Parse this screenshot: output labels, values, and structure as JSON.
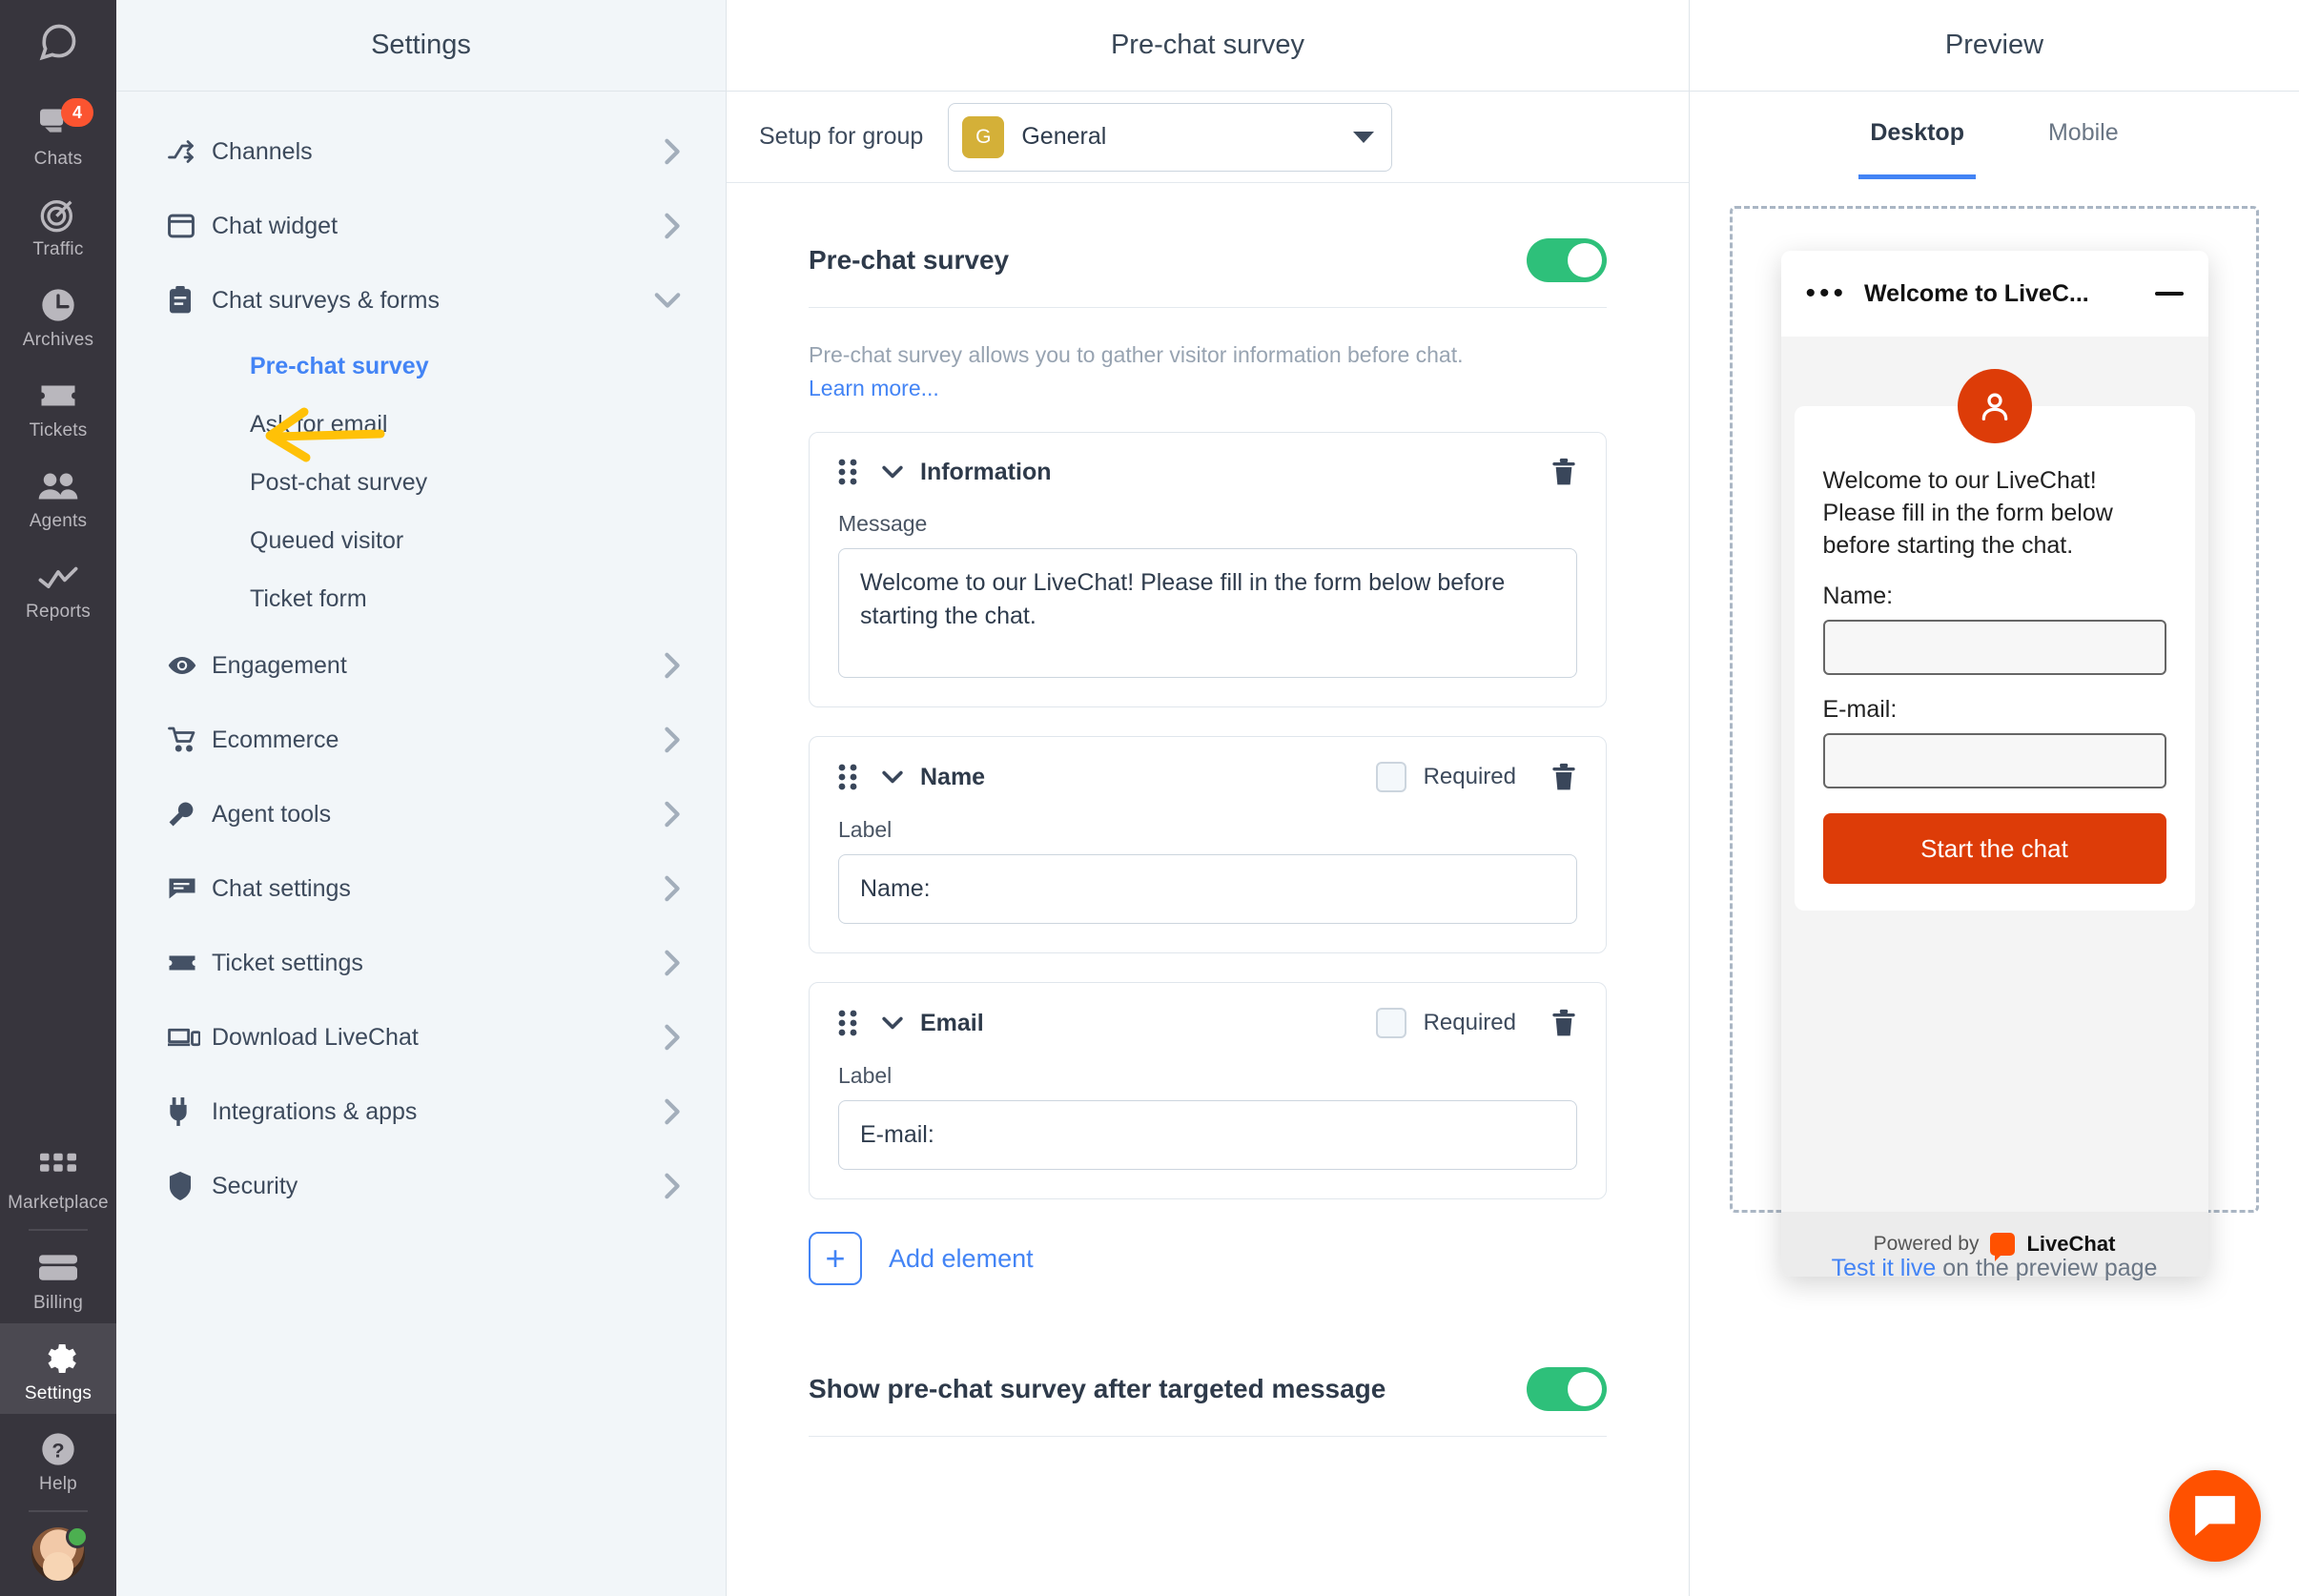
{
  "rail": {
    "logo_icon": "livechat-logo-icon",
    "items": [
      {
        "label": "Chats",
        "icon": "chats-icon",
        "badge": "4",
        "active": false
      },
      {
        "label": "Traffic",
        "icon": "traffic-icon",
        "badge": "",
        "active": false
      },
      {
        "label": "Archives",
        "icon": "archives-clock-icon",
        "badge": "",
        "active": false
      },
      {
        "label": "Tickets",
        "icon": "tickets-icon",
        "badge": "",
        "active": false
      },
      {
        "label": "Agents",
        "icon": "agents-icon",
        "badge": "",
        "active": false
      },
      {
        "label": "Reports",
        "icon": "reports-chart-icon",
        "badge": "",
        "active": false
      }
    ],
    "bottom_items": [
      {
        "label": "Marketplace",
        "icon": "marketplace-grid-icon",
        "active": false
      },
      {
        "label": "Billing",
        "icon": "billing-card-icon",
        "active": false
      },
      {
        "label": "Settings",
        "icon": "gear-icon",
        "active": true
      },
      {
        "label": "Help",
        "icon": "help-question-icon",
        "active": false
      }
    ]
  },
  "settings": {
    "title": "Settings",
    "items": [
      {
        "label": "Channels",
        "icon": "channels-icon",
        "type": "parent",
        "expanded": false
      },
      {
        "label": "Chat widget",
        "icon": "chat-widget-icon",
        "type": "parent",
        "expanded": false
      },
      {
        "label": "Chat surveys & forms",
        "icon": "clipboard-icon",
        "type": "parent",
        "expanded": true
      },
      {
        "label": "Pre-chat survey",
        "type": "child",
        "active": true
      },
      {
        "label": "Ask for email",
        "type": "child",
        "active": false
      },
      {
        "label": "Post-chat survey",
        "type": "child",
        "active": false
      },
      {
        "label": "Queued visitor",
        "type": "child",
        "active": false
      },
      {
        "label": "Ticket form",
        "type": "child",
        "active": false
      },
      {
        "label": "Engagement",
        "icon": "eye-icon",
        "type": "parent",
        "expanded": false
      },
      {
        "label": "Ecommerce",
        "icon": "cart-icon",
        "type": "parent",
        "expanded": false
      },
      {
        "label": "Agent tools",
        "icon": "wrench-icon",
        "type": "parent",
        "expanded": false
      },
      {
        "label": "Chat settings",
        "icon": "chat-bubble-icon",
        "type": "parent",
        "expanded": false
      },
      {
        "label": "Ticket settings",
        "icon": "ticket-icon",
        "type": "parent",
        "expanded": false
      },
      {
        "label": "Download LiveChat",
        "icon": "devices-icon",
        "type": "parent",
        "expanded": false
      },
      {
        "label": "Integrations & apps",
        "icon": "plug-icon",
        "type": "parent",
        "expanded": false
      },
      {
        "label": "Security",
        "icon": "shield-icon",
        "type": "parent",
        "expanded": false
      }
    ]
  },
  "main": {
    "title": "Pre-chat survey",
    "setup_for_group_label": "Setup for group",
    "group": {
      "initial": "G",
      "name": "General",
      "color": "#d4b038"
    },
    "section": {
      "title": "Pre-chat survey",
      "enabled": true,
      "description": "Pre-chat survey allows you to gather visitor information before chat.",
      "learn_more": "Learn more..."
    },
    "elements": [
      {
        "name": "Information",
        "field_label": "Message",
        "value": "Welcome to our LiveChat! Please fill in the form below before starting the chat.",
        "has_required": false,
        "required": false
      },
      {
        "name": "Name",
        "field_label": "Label",
        "value": "Name:",
        "has_required": true,
        "required": false,
        "required_label": "Required"
      },
      {
        "name": "Email",
        "field_label": "Label",
        "value": "E-mail:",
        "has_required": true,
        "required": false,
        "required_label": "Required"
      }
    ],
    "add_element_label": "Add element",
    "targeted": {
      "label": "Show pre-chat survey after targeted message",
      "enabled": true
    }
  },
  "preview": {
    "title": "Preview",
    "tabs": [
      {
        "label": "Desktop",
        "active": true
      },
      {
        "label": "Mobile",
        "active": false
      }
    ],
    "widget": {
      "header_title": "Welcome to LiveC...",
      "dots": "•••",
      "message": "Welcome to our LiveChat! Please fill in the form below before starting the chat.",
      "fields": [
        {
          "label": "Name:",
          "value": ""
        },
        {
          "label": "E-mail:",
          "value": ""
        }
      ],
      "start_button": "Start the chat",
      "powered_by": "Powered by",
      "brand": "LiveChat"
    },
    "test_live_link": "Test it live",
    "test_live_rest": " on the preview page"
  },
  "colors": {
    "accent_blue": "#4384f5",
    "toggle_green": "#2ec07a",
    "brand_orange": "#dd3c08",
    "badge_red": "#fb5430",
    "group_yellow": "#d4b038",
    "annotation_yellow": "#ffc107"
  }
}
